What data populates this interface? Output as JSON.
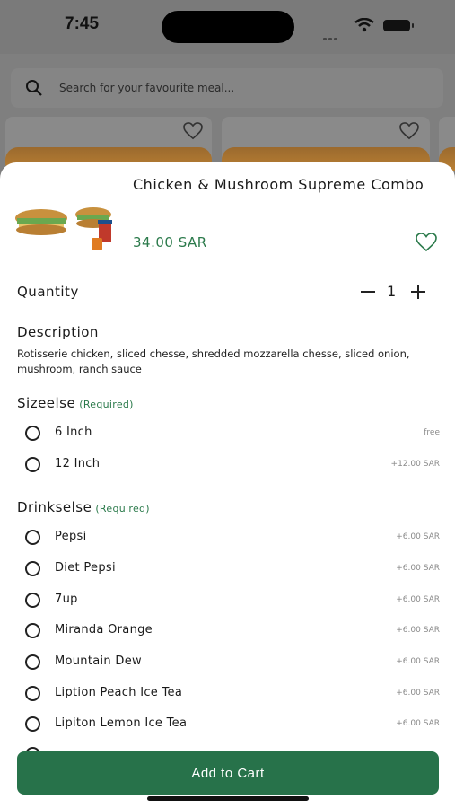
{
  "status_bar": {
    "time": "7:45"
  },
  "background": {
    "search_placeholder": "Search for your favourite meal..."
  },
  "product": {
    "name": "Chicken & Mushroom Supreme Combo",
    "price": "34.00 SAR"
  },
  "quantity": {
    "label": "Quantity",
    "value": "1"
  },
  "description": {
    "title": "Description",
    "text": "Rotisserie chicken, sliced chesse, shredded mozzarella chesse, sliced onion, mushroom, ranch sauce"
  },
  "sizes": {
    "title": "Sizeelse",
    "required": "(Required)",
    "options": [
      {
        "label": "6 Inch",
        "price": "free"
      },
      {
        "label": "12 Inch",
        "price": "+12.00 SAR"
      }
    ]
  },
  "drinks": {
    "title": "Drinkselse",
    "required": "(Required)",
    "options": [
      {
        "label": "Pepsi",
        "price": "+6.00 SAR"
      },
      {
        "label": "Diet Pepsi",
        "price": "+6.00 SAR"
      },
      {
        "label": "7up",
        "price": "+6.00 SAR"
      },
      {
        "label": "Miranda Orange",
        "price": "+6.00 SAR"
      },
      {
        "label": "Mountain Dew",
        "price": "+6.00 SAR"
      },
      {
        "label": "Liption Peach Ice Tea",
        "price": "+6.00 SAR"
      },
      {
        "label": "Lipiton Lemon Ice Tea",
        "price": "+6.00 SAR"
      }
    ]
  },
  "cart_button": {
    "label": "Add to Cart"
  },
  "colors": {
    "accent_green": "#27724a",
    "price_green": "#2b7a4b",
    "overlay": "#7f7f7f"
  }
}
